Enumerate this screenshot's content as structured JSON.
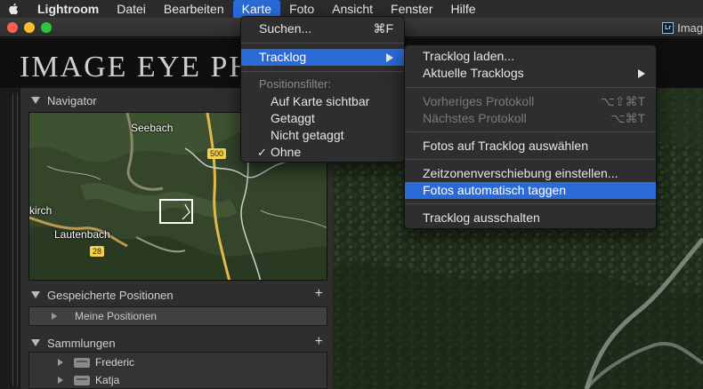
{
  "menubar": {
    "app_name": "Lightroom",
    "items": [
      "Datei",
      "Bearbeiten",
      "Karte",
      "Foto",
      "Ansicht",
      "Fenster",
      "Hilfe"
    ]
  },
  "window": {
    "title": "Imag",
    "app_badge": "Lr"
  },
  "identity_plate": "IMAGE EYE PHO",
  "left_panel": {
    "navigator": {
      "title": "Navigator"
    },
    "map_labels": {
      "seebach": "Seebach",
      "kirch": "kirch",
      "lautenbach": "Lautenbach"
    },
    "road_badges": {
      "r500": "500",
      "r28": "28"
    },
    "saved_positions": {
      "title": "Gespeicherte Positionen",
      "item": "Meine Positionen"
    },
    "collections": {
      "title": "Sammlungen",
      "items": [
        "Frederic",
        "Katja"
      ]
    }
  },
  "karte_menu": {
    "search": {
      "label": "Suchen...",
      "shortcut": "⌘F"
    },
    "tracklog": "Tracklog",
    "filter_heading": "Positionsfilter:",
    "filters": [
      "Auf Karte sichtbar",
      "Getaggt",
      "Nicht getaggt",
      "Ohne"
    ],
    "checked_filter": "Ohne",
    "checkmark": "✓"
  },
  "tracklog_menu": {
    "load": "Tracklog laden...",
    "recent": "Aktuelle Tracklogs",
    "previous": {
      "label": "Vorheriges Protokoll",
      "shortcut": "⌥⇧⌘T"
    },
    "next": {
      "label": "Nächstes Protokoll",
      "shortcut": "⌥⌘T"
    },
    "select_photos": "Fotos auf Tracklog auswählen",
    "timezone": "Zeitzonenverschiebung einstellen...",
    "auto_tag": "Fotos automatisch taggen",
    "turn_off": "Tracklog ausschalten"
  },
  "colors": {
    "accent": "#2a6ad7",
    "menubar": "#2b2b2b",
    "panel": "#2e2e2e"
  }
}
